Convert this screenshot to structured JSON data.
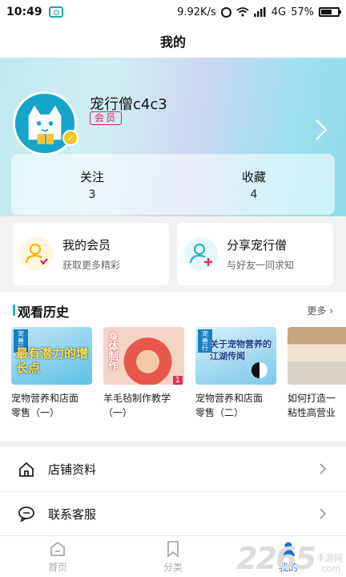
{
  "status_bar": {
    "time": "10:49",
    "speed": "9.92K/s",
    "network": "4G",
    "battery": "57%"
  },
  "nav": {
    "title": "我的"
  },
  "profile": {
    "username": "宠行僧c4c3",
    "badge": "会员"
  },
  "stats": [
    {
      "label": "关注",
      "value": "3"
    },
    {
      "label": "收藏",
      "value": "4"
    }
  ],
  "quick_cards": [
    {
      "title": "我的会员",
      "subtitle": "获取更多精彩",
      "icon": "member-user-icon"
    },
    {
      "title": "分享宠行僧",
      "subtitle": "与好友一同求知",
      "icon": "share-user-icon"
    }
  ],
  "history": {
    "title": "观看历史",
    "more": "更多",
    "items": [
      {
        "line1": "宠物营养和店面",
        "line2": "零售（一）",
        "thumb_text": "最有潜力的增长点",
        "thumb_tag": "宠善行"
      },
      {
        "line1": "羊毛毡制作教学",
        "line2": "（一）",
        "thumb_text": "身体制作",
        "thumb_num": "1"
      },
      {
        "line1": "宠物营养和店面",
        "line2": "零售（二）",
        "thumb_text": "关于宠物营养的江湖传闻",
        "thumb_tag": "宠善行"
      },
      {
        "line1": "如何打造一",
        "line2": "粘性高营业",
        "thumb_text": ""
      }
    ]
  },
  "menu": [
    {
      "label": "店铺资料",
      "icon": "home-icon"
    },
    {
      "label": "联系客服",
      "icon": "chat-icon"
    }
  ],
  "tabs": [
    {
      "label": "首页",
      "icon": "home-tab-icon",
      "active": false
    },
    {
      "label": "分类",
      "icon": "bookmark-tab-icon",
      "active": false
    },
    {
      "label": "我的",
      "icon": "profile-tab-icon",
      "active": true
    }
  ],
  "watermark": {
    "number": "2265",
    "site": "手游网",
    "domain": ".com"
  },
  "colors": {
    "accent": "#1a6fd6",
    "teal": "#16a5c8",
    "badge_red": "#e0245e"
  }
}
